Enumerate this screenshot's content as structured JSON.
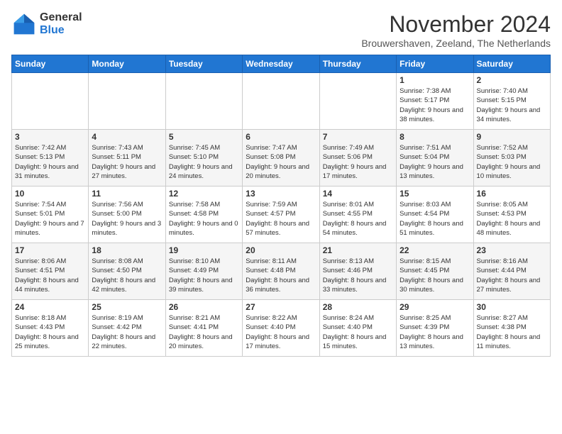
{
  "logo": {
    "line1": "General",
    "line2": "Blue"
  },
  "title": "November 2024",
  "subtitle": "Brouwershaven, Zeeland, The Netherlands",
  "days_of_week": [
    "Sunday",
    "Monday",
    "Tuesday",
    "Wednesday",
    "Thursday",
    "Friday",
    "Saturday"
  ],
  "weeks": [
    [
      {
        "day": "",
        "info": ""
      },
      {
        "day": "",
        "info": ""
      },
      {
        "day": "",
        "info": ""
      },
      {
        "day": "",
        "info": ""
      },
      {
        "day": "",
        "info": ""
      },
      {
        "day": "1",
        "info": "Sunrise: 7:38 AM\nSunset: 5:17 PM\nDaylight: 9 hours and 38 minutes."
      },
      {
        "day": "2",
        "info": "Sunrise: 7:40 AM\nSunset: 5:15 PM\nDaylight: 9 hours and 34 minutes."
      }
    ],
    [
      {
        "day": "3",
        "info": "Sunrise: 7:42 AM\nSunset: 5:13 PM\nDaylight: 9 hours and 31 minutes."
      },
      {
        "day": "4",
        "info": "Sunrise: 7:43 AM\nSunset: 5:11 PM\nDaylight: 9 hours and 27 minutes."
      },
      {
        "day": "5",
        "info": "Sunrise: 7:45 AM\nSunset: 5:10 PM\nDaylight: 9 hours and 24 minutes."
      },
      {
        "day": "6",
        "info": "Sunrise: 7:47 AM\nSunset: 5:08 PM\nDaylight: 9 hours and 20 minutes."
      },
      {
        "day": "7",
        "info": "Sunrise: 7:49 AM\nSunset: 5:06 PM\nDaylight: 9 hours and 17 minutes."
      },
      {
        "day": "8",
        "info": "Sunrise: 7:51 AM\nSunset: 5:04 PM\nDaylight: 9 hours and 13 minutes."
      },
      {
        "day": "9",
        "info": "Sunrise: 7:52 AM\nSunset: 5:03 PM\nDaylight: 9 hours and 10 minutes."
      }
    ],
    [
      {
        "day": "10",
        "info": "Sunrise: 7:54 AM\nSunset: 5:01 PM\nDaylight: 9 hours and 7 minutes."
      },
      {
        "day": "11",
        "info": "Sunrise: 7:56 AM\nSunset: 5:00 PM\nDaylight: 9 hours and 3 minutes."
      },
      {
        "day": "12",
        "info": "Sunrise: 7:58 AM\nSunset: 4:58 PM\nDaylight: 9 hours and 0 minutes."
      },
      {
        "day": "13",
        "info": "Sunrise: 7:59 AM\nSunset: 4:57 PM\nDaylight: 8 hours and 57 minutes."
      },
      {
        "day": "14",
        "info": "Sunrise: 8:01 AM\nSunset: 4:55 PM\nDaylight: 8 hours and 54 minutes."
      },
      {
        "day": "15",
        "info": "Sunrise: 8:03 AM\nSunset: 4:54 PM\nDaylight: 8 hours and 51 minutes."
      },
      {
        "day": "16",
        "info": "Sunrise: 8:05 AM\nSunset: 4:53 PM\nDaylight: 8 hours and 48 minutes."
      }
    ],
    [
      {
        "day": "17",
        "info": "Sunrise: 8:06 AM\nSunset: 4:51 PM\nDaylight: 8 hours and 44 minutes."
      },
      {
        "day": "18",
        "info": "Sunrise: 8:08 AM\nSunset: 4:50 PM\nDaylight: 8 hours and 42 minutes."
      },
      {
        "day": "19",
        "info": "Sunrise: 8:10 AM\nSunset: 4:49 PM\nDaylight: 8 hours and 39 minutes."
      },
      {
        "day": "20",
        "info": "Sunrise: 8:11 AM\nSunset: 4:48 PM\nDaylight: 8 hours and 36 minutes."
      },
      {
        "day": "21",
        "info": "Sunrise: 8:13 AM\nSunset: 4:46 PM\nDaylight: 8 hours and 33 minutes."
      },
      {
        "day": "22",
        "info": "Sunrise: 8:15 AM\nSunset: 4:45 PM\nDaylight: 8 hours and 30 minutes."
      },
      {
        "day": "23",
        "info": "Sunrise: 8:16 AM\nSunset: 4:44 PM\nDaylight: 8 hours and 27 minutes."
      }
    ],
    [
      {
        "day": "24",
        "info": "Sunrise: 8:18 AM\nSunset: 4:43 PM\nDaylight: 8 hours and 25 minutes."
      },
      {
        "day": "25",
        "info": "Sunrise: 8:19 AM\nSunset: 4:42 PM\nDaylight: 8 hours and 22 minutes."
      },
      {
        "day": "26",
        "info": "Sunrise: 8:21 AM\nSunset: 4:41 PM\nDaylight: 8 hours and 20 minutes."
      },
      {
        "day": "27",
        "info": "Sunrise: 8:22 AM\nSunset: 4:40 PM\nDaylight: 8 hours and 17 minutes."
      },
      {
        "day": "28",
        "info": "Sunrise: 8:24 AM\nSunset: 4:40 PM\nDaylight: 8 hours and 15 minutes."
      },
      {
        "day": "29",
        "info": "Sunrise: 8:25 AM\nSunset: 4:39 PM\nDaylight: 8 hours and 13 minutes."
      },
      {
        "day": "30",
        "info": "Sunrise: 8:27 AM\nSunset: 4:38 PM\nDaylight: 8 hours and 11 minutes."
      }
    ]
  ]
}
